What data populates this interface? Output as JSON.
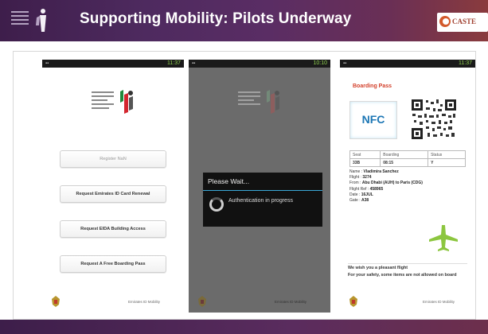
{
  "header": {
    "title": "Supporting Mobility: Pilots Underway",
    "logo_text": "CASTE"
  },
  "phone1": {
    "time": "11:37",
    "register_label": "Register NaN",
    "buttons": [
      "Request Emirates ID Card Renewal",
      "Request EIDA Building Access",
      "Request A Free Boarding Pass"
    ],
    "footer_text": "Emirates ID Mobility"
  },
  "phone2": {
    "time": "10:10",
    "dialog_title": "Please Wait...",
    "dialog_message": "Authentication in progress",
    "footer_text": "Emirates ID Mobility"
  },
  "phone3": {
    "time": "11:37",
    "title": "Boarding Pass",
    "nfc": "NFC",
    "table": {
      "headers": [
        "Seat",
        "Boarding",
        "Status"
      ],
      "values": [
        "33B",
        "08:15",
        "Y"
      ]
    },
    "details": [
      {
        "label": "Name :",
        "value": "Vladimira Sanchez"
      },
      {
        "label": "Flight :",
        "value": "3274"
      },
      {
        "label": "From :",
        "value": "Abu Dhabi (AUH) to  Paris (CDG)"
      },
      {
        "label": "Flight Ref :",
        "value": "458965"
      },
      {
        "label": "Date :",
        "value": "16JUL"
      },
      {
        "label": "Gate :",
        "value": "A38"
      }
    ],
    "wish": "We wish you a pleasant flight",
    "safety": "For your safety, some items are not allowed on board",
    "footer_text": "Emirates ID Mobility"
  },
  "colors": {
    "header_start": "#3e1e4b",
    "header_end": "#8a3b3d",
    "accent_red": "#d3402b",
    "nfc_blue": "#1d77b5",
    "plane_green": "#8cc63f",
    "status_green": "#8fd14f"
  }
}
